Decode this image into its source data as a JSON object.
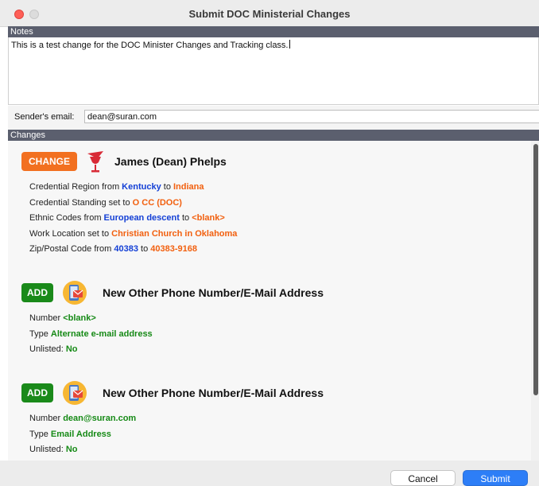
{
  "window": {
    "title": "Submit DOC Ministerial Changes"
  },
  "notes": {
    "header": "Notes",
    "text": "This is a test change for the DOC Minister Changes and Tracking class."
  },
  "sender": {
    "label": "Sender's email:",
    "value": "dean@suran.com"
  },
  "changes": {
    "header": "Changes",
    "blocks": [
      {
        "badge": "CHANGE",
        "icon": "chalice-icon",
        "title": "James (Dean) Phelps",
        "lines": [
          {
            "label": "Credential Region from ",
            "old": "Kentucky",
            "to": " to ",
            "new": "Indiana"
          },
          {
            "label": "Credential Standing set to ",
            "new": "O CC (DOC)"
          },
          {
            "label": "Ethnic Codes from ",
            "old": "European descent",
            "to": " to ",
            "new": "<blank>"
          },
          {
            "label": "Work Location set to ",
            "new": "Christian Church in Oklahoma"
          },
          {
            "label": "Zip/Postal Code from ",
            "old": "40383",
            "to": " to ",
            "new": "40383-9168"
          }
        ]
      },
      {
        "badge": "ADD",
        "icon": "phone-email-icon",
        "title": "New Other Phone Number/E-Mail Address",
        "lines": [
          {
            "label": "Number ",
            "value": "<blank>"
          },
          {
            "label": "Type ",
            "value": "Alternate e-mail address"
          },
          {
            "label": "Unlisted: ",
            "value": "No"
          }
        ]
      },
      {
        "badge": "ADD",
        "icon": "phone-email-icon",
        "title": "New Other Phone Number/E-Mail Address",
        "lines": [
          {
            "label": "Number ",
            "value": "dean@suran.com"
          },
          {
            "label": "Type ",
            "value": "Email Address"
          },
          {
            "label": "Unlisted: ",
            "value": "No"
          }
        ]
      }
    ]
  },
  "buttons": {
    "cancel": "Cancel",
    "submit": "Submit"
  },
  "colors": {
    "change_badge": "#f27020",
    "add_badge": "#1a8a1a",
    "old_value": "#1440d6",
    "new_value": "#f2600f",
    "added_value": "#168a16",
    "submit_button": "#2d7ef7"
  }
}
